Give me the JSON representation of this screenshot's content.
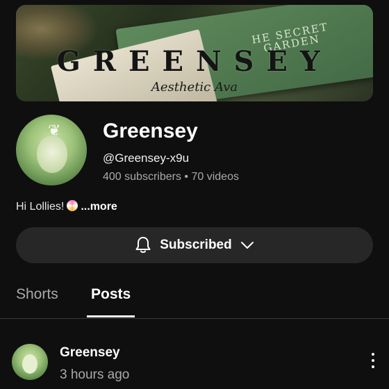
{
  "banner": {
    "brand": "GREENSEY",
    "tagline": "Aesthetic Ava",
    "book_title_line1": "HE SECRET",
    "book_title_line2": "GARDEN"
  },
  "channel": {
    "name": "Greensey",
    "handle": "@Greensey-x9u",
    "subscribers": "400 subscribers",
    "separator": "•",
    "videos": "70 videos",
    "description": "Hi Lollies!",
    "more_label": "...more"
  },
  "subscribe_button": {
    "label": "Subscribed",
    "icon": "bell-icon",
    "dropdown_icon": "chevron-down-icon"
  },
  "tabs": [
    {
      "label": "Shorts",
      "active": false
    },
    {
      "label": "Posts",
      "active": true
    }
  ],
  "post": {
    "author": "Greensey",
    "time": "3 hours ago",
    "menu_icon": "more-vertical-icon"
  },
  "colors": {
    "background": "#0f0f0f",
    "button_bg": "#272727",
    "secondary_text": "#aaaaaa",
    "primary_text": "#ffffff"
  }
}
